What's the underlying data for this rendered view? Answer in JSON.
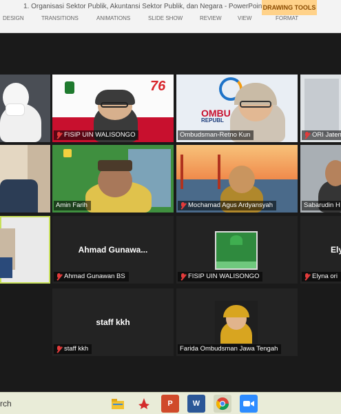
{
  "ppt": {
    "title": "1. Organisasi Sektor Publik, Akuntansi Sektor Publik, dan Negara - PowerPoint",
    "context_tab": "DRAWING TOOLS",
    "ribbon_tabs": [
      "DESIGN",
      "TRANSITIONS",
      "ANIMATIONS",
      "SLIDE SHOW",
      "REVIEW",
      "VIEW",
      "FORMAT"
    ]
  },
  "tiles": [
    {
      "name": ""
    },
    {
      "name": "FISIP UIN WALISONGO"
    },
    {
      "name": "Ombudsman-Retno Kun"
    },
    {
      "name": "ORI Jateng"
    },
    {
      "name": ""
    },
    {
      "name": "Amin Farih"
    },
    {
      "name": "Mochamad Agus Ardyansyah"
    },
    {
      "name": "Sabarudin H"
    },
    {
      "name": ""
    },
    {
      "name": "Ahmad Gunawan BS",
      "center": "Ahmad  Gunawa..."
    },
    {
      "name": "FISIP UIN WALISONGO"
    },
    {
      "name": "Elyna ori",
      "center": "Ely"
    },
    {
      "name": "staff kkh",
      "center": "staff kkh"
    },
    {
      "name": "Farida Ombudsman Jawa Tengah"
    }
  ],
  "banner": {
    "seventy_six": "76",
    "ombud_text": "OMBU",
    "republik_text": "REPUBL"
  },
  "taskbar": {
    "search": "rch",
    "icons": [
      "file-explorer-icon",
      "pdf-icon",
      "powerpoint-icon",
      "word-icon",
      "chrome-icon",
      "zoom-icon"
    ]
  },
  "colors": {
    "highlight": "#c7e05a",
    "muted": "#e23b3b",
    "zoom_blue": "#2d8cff"
  }
}
